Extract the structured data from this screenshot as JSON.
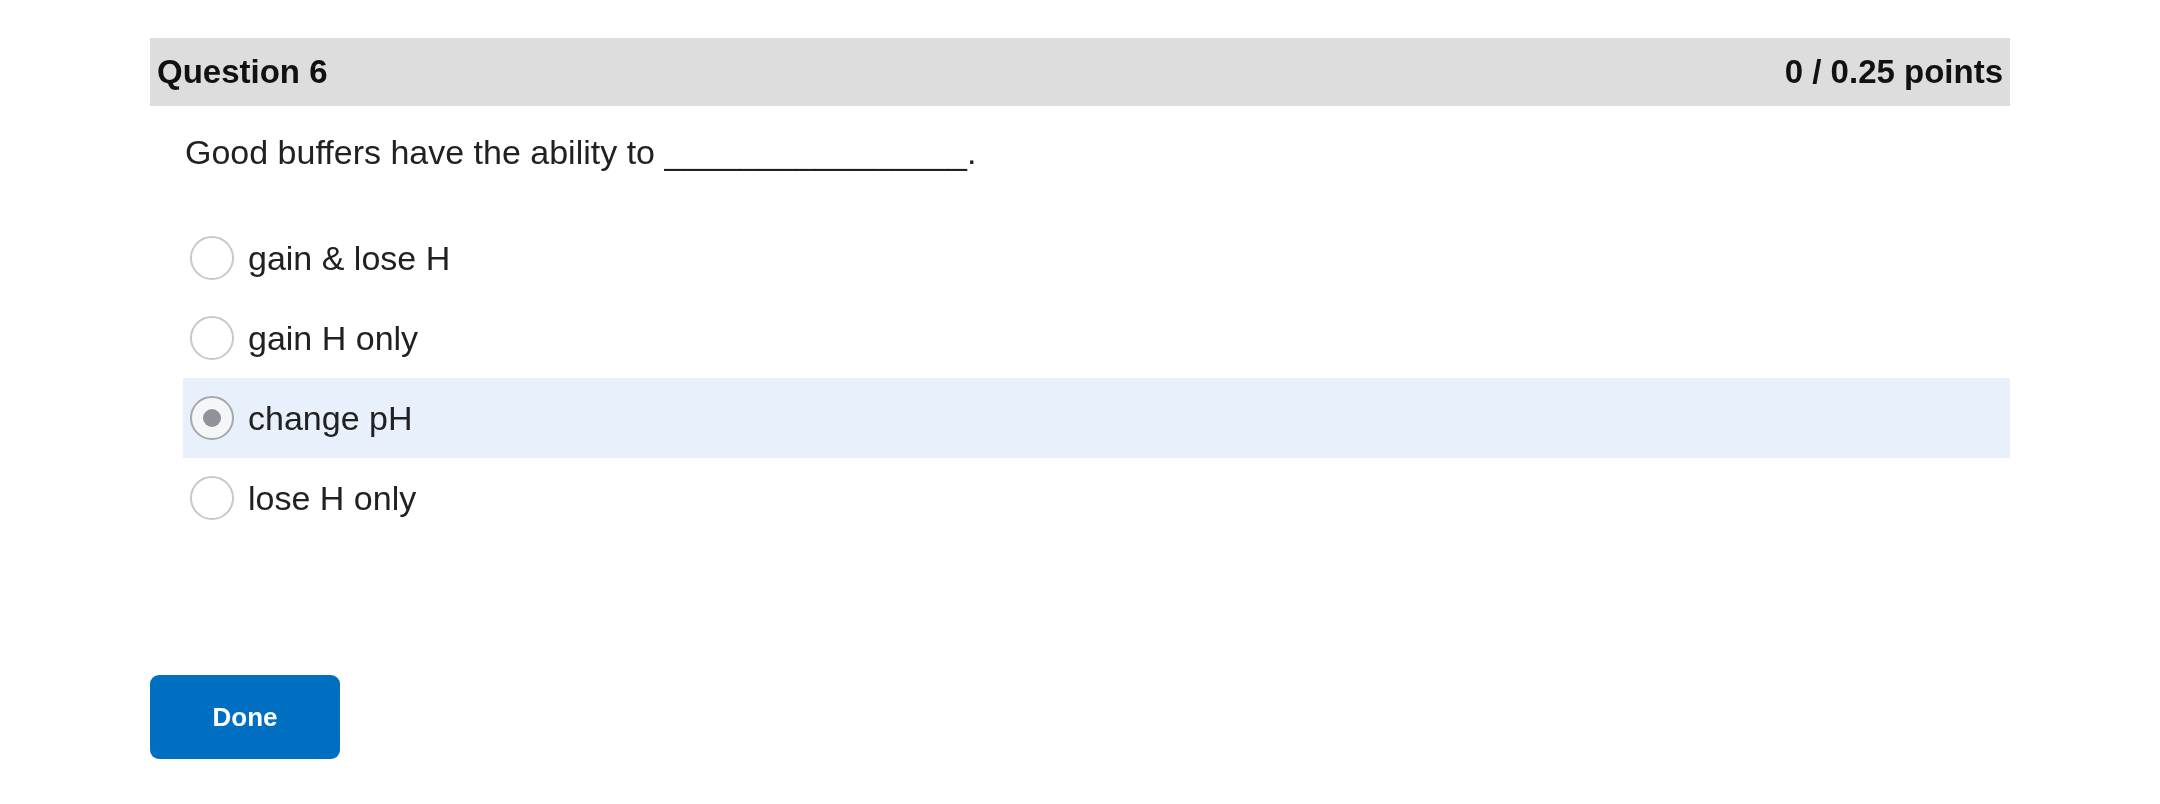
{
  "question": {
    "title": "Question 6",
    "score": "0 / 0.25 points",
    "text": "Good buffers have the ability to ________________."
  },
  "options": [
    {
      "label": "gain & lose H",
      "selected": false
    },
    {
      "label": "gain H only",
      "selected": false
    },
    {
      "label": "change pH",
      "selected": true
    },
    {
      "label": "lose H only",
      "selected": false
    }
  ],
  "buttons": [
    {
      "label": "Done"
    }
  ]
}
